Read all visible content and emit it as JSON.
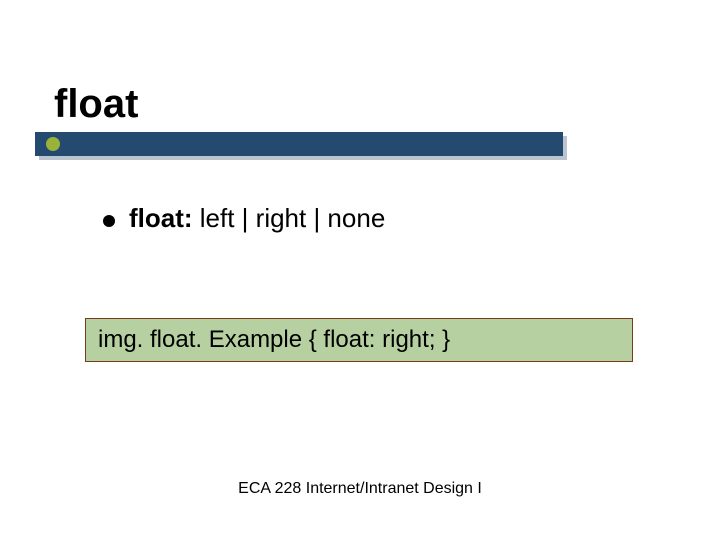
{
  "slide": {
    "title": "float",
    "bullet": {
      "label": "float:",
      "values": "  left | right | none"
    },
    "code_example": "img. float. Example { float: right; }",
    "footer": "ECA 228  Internet/Intranet Design I"
  },
  "colors": {
    "bar": "#244a6f",
    "accent": "#9ab23a",
    "code_bg": "#b6d0a2",
    "code_border": "#7a3a1a"
  }
}
